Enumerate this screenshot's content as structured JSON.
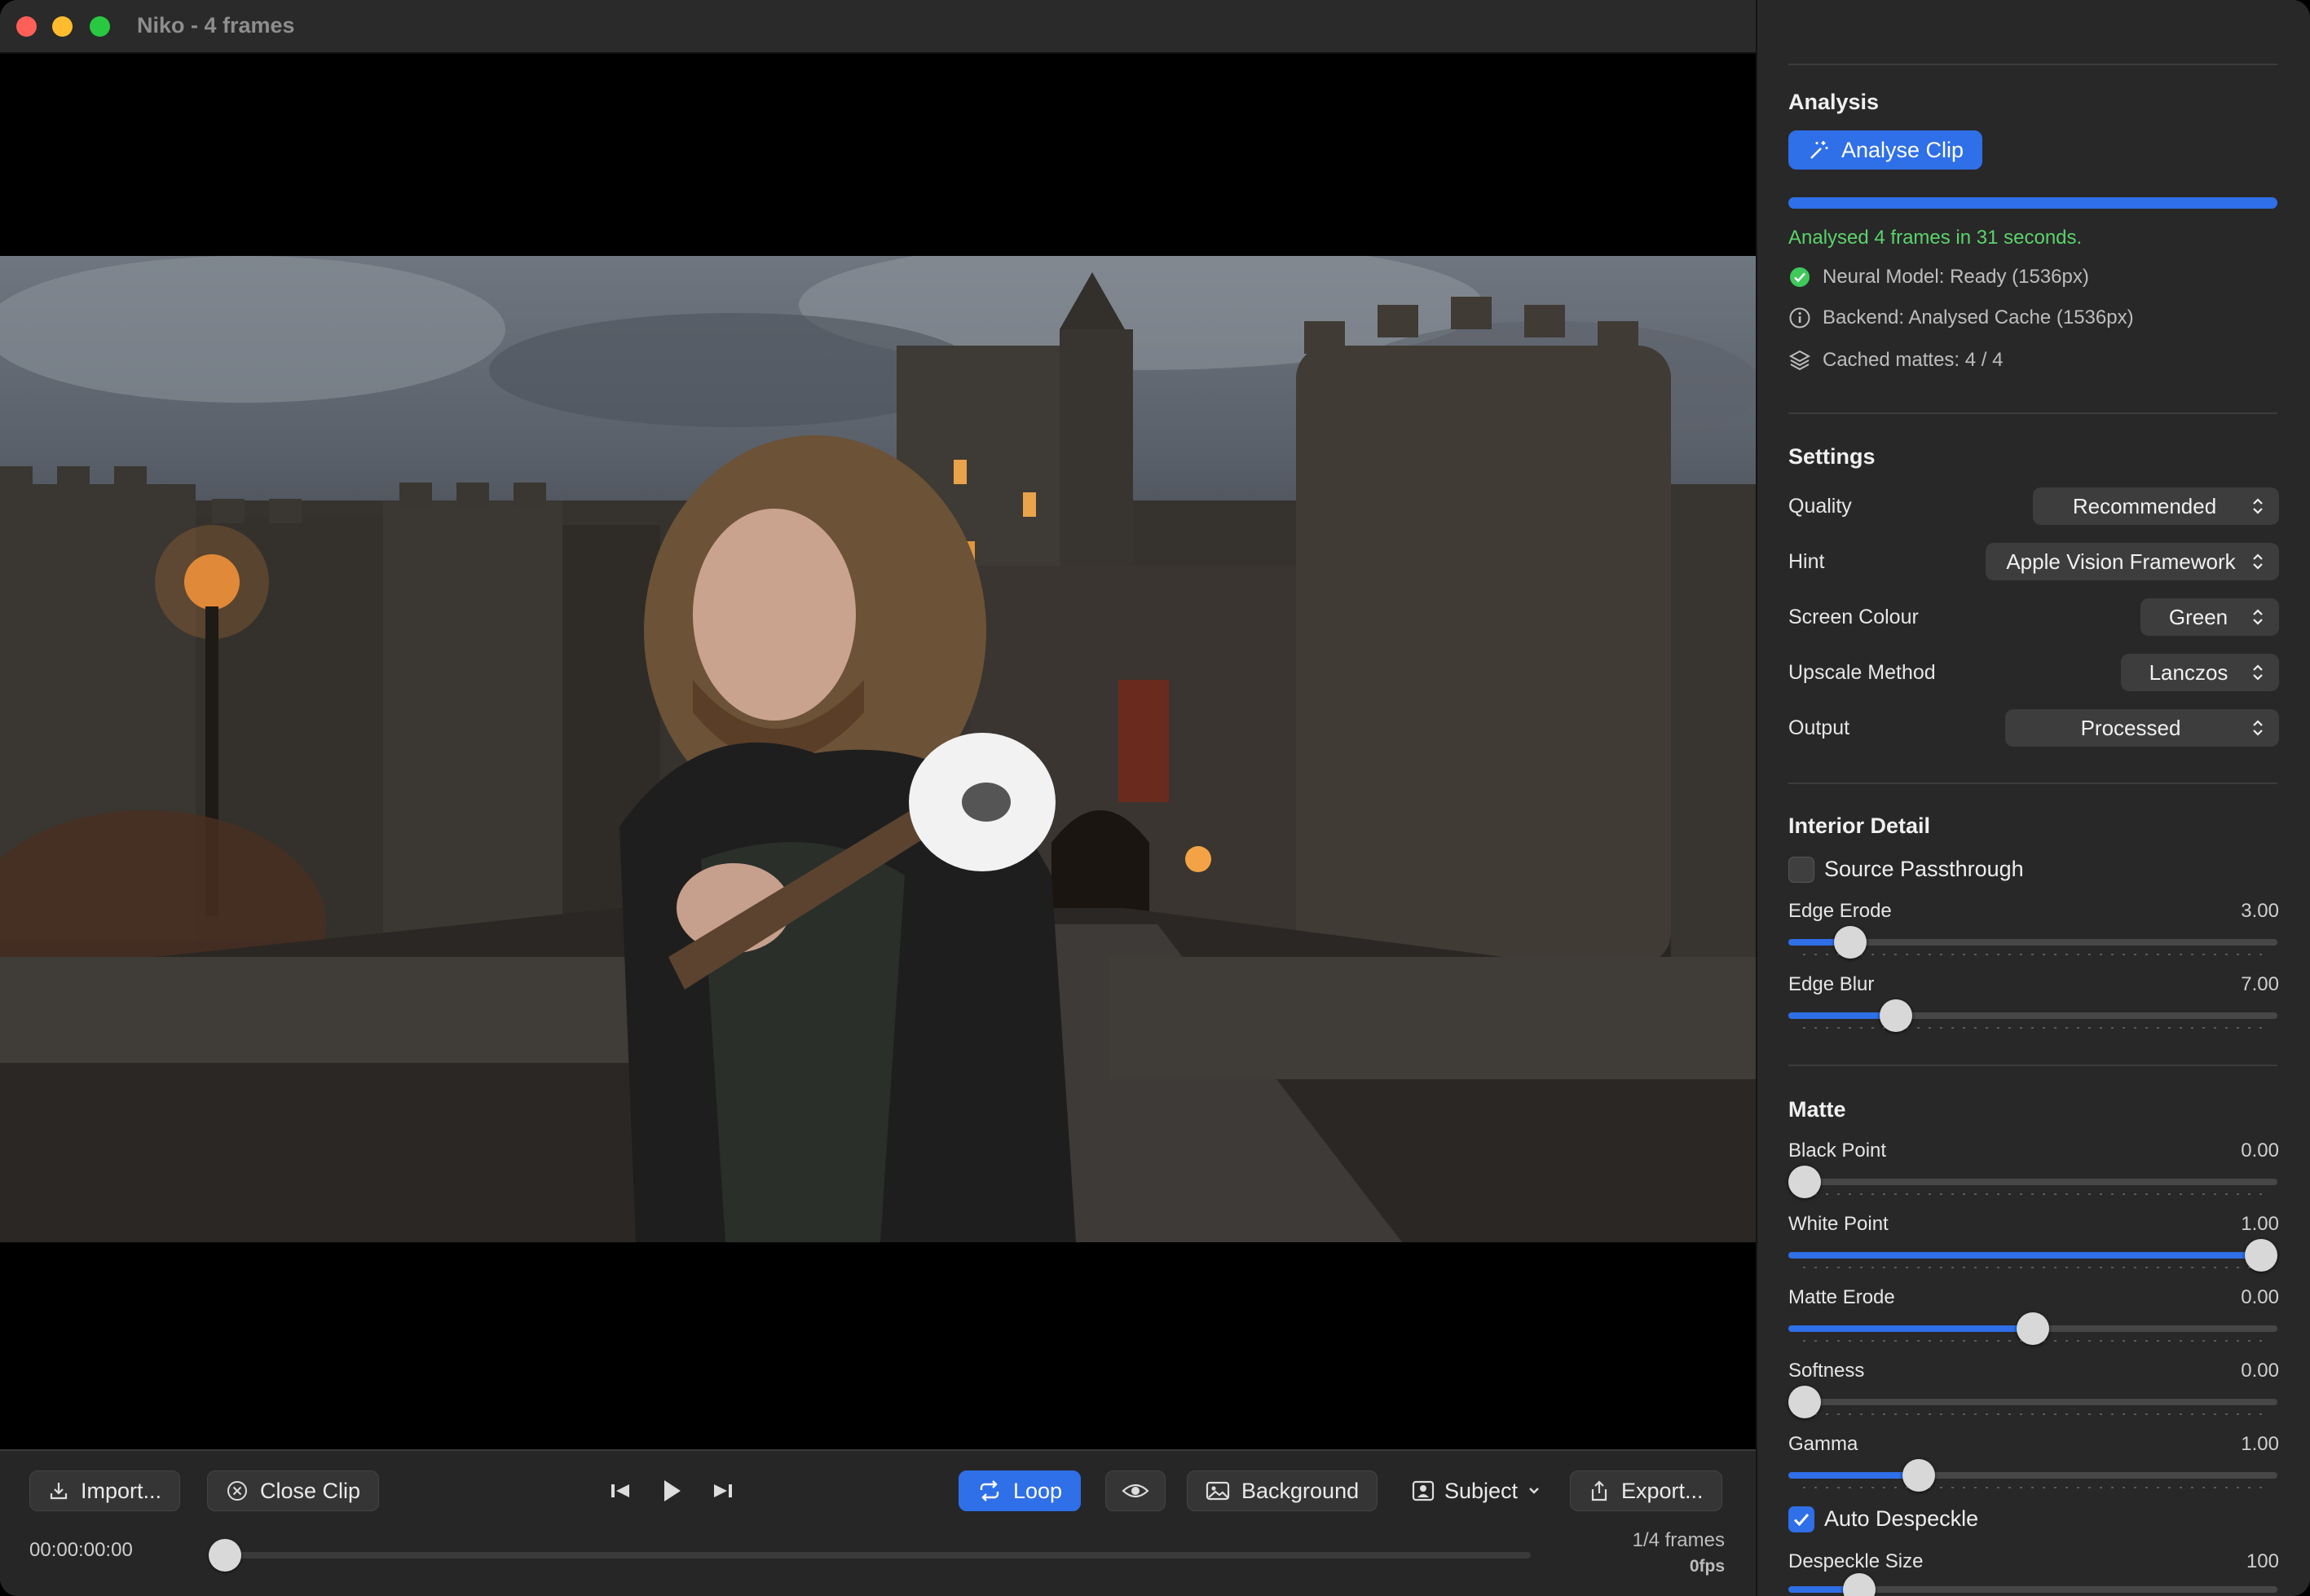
{
  "window": {
    "title": "Niko - 4 frames"
  },
  "controls": {
    "import_label": "Import...",
    "close_clip_label": "Close Clip",
    "loop_label": "Loop",
    "background_label": "Background",
    "subject_label": "Subject",
    "export_label": "Export...",
    "timecode": "00:00:00:00",
    "frame_counter": "1/4 frames",
    "fps": "0fps",
    "accent_color": "#2f6fe8"
  },
  "panel": {
    "analysis": {
      "title": "Analysis",
      "analyse_button": "Analyse Clip",
      "progress": 1.0,
      "status": "Analysed 4 frames in 31 seconds.",
      "neural_model": "Neural Model: Ready (1536px)",
      "backend": "Backend: Analysed Cache (1536px)",
      "cached_mattes": "Cached mattes: 4 / 4"
    },
    "settings": {
      "title": "Settings",
      "quality": {
        "label": "Quality",
        "value": "Recommended"
      },
      "hint": {
        "label": "Hint",
        "value": "Apple Vision Framework"
      },
      "screen_colour": {
        "label": "Screen Colour",
        "value": "Green"
      },
      "upscale_method": {
        "label": "Upscale Method",
        "value": "Lanczos"
      },
      "output": {
        "label": "Output",
        "value": "Processed"
      }
    },
    "interior_detail": {
      "title": "Interior Detail",
      "source_passthrough": {
        "label": "Source Passthrough",
        "checked": false
      },
      "edge_erode": {
        "label": "Edge Erode",
        "value": "3.00",
        "fraction": 0.1
      },
      "edge_blur": {
        "label": "Edge Blur",
        "value": "7.00",
        "fraction": 0.2
      }
    },
    "matte": {
      "title": "Matte",
      "black_point": {
        "label": "Black Point",
        "value": "0.00",
        "fraction": 0.0
      },
      "white_point": {
        "label": "White Point",
        "value": "1.00",
        "fraction": 1.0
      },
      "matte_erode": {
        "label": "Matte Erode",
        "value": "0.00",
        "fraction": 0.5
      },
      "softness": {
        "label": "Softness",
        "value": "0.00",
        "fraction": 0.0
      },
      "gamma": {
        "label": "Gamma",
        "value": "1.00",
        "fraction": 0.25
      },
      "auto_despeckle": {
        "label": "Auto Despeckle",
        "checked": true
      },
      "despeckle_size": {
        "label": "Despeckle Size",
        "value": "100",
        "fraction": 0.12
      }
    }
  }
}
